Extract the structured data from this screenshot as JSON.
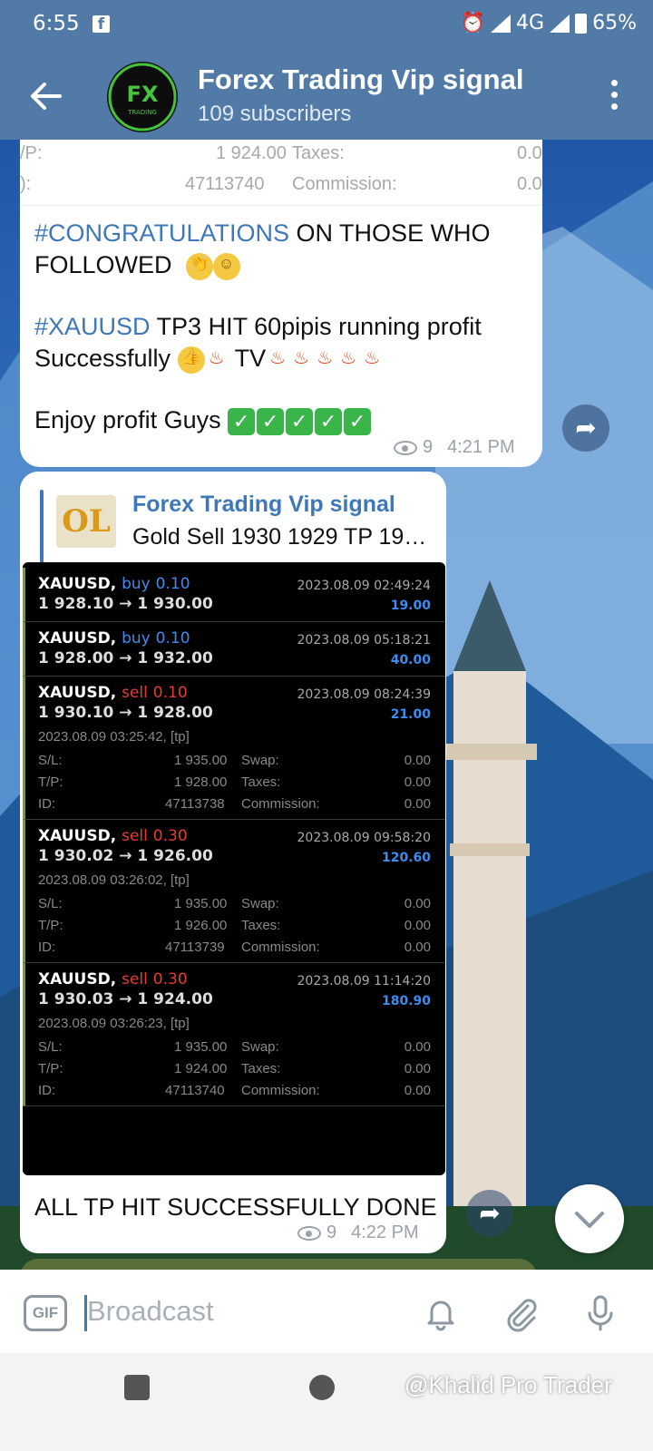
{
  "status_bar": {
    "time": "6:55",
    "network": "4G",
    "battery": "65%",
    "fb_label": "f"
  },
  "header": {
    "title": "Forex Trading Vip signal",
    "subscribers": "109 subscribers",
    "avatar_text": "FX",
    "avatar_sub": "TRADING"
  },
  "message1": {
    "partial_rows": [
      {
        "label": "/P:",
        "value": "1 924.00",
        "key": "Taxes:",
        "amount": "0.0"
      },
      {
        "label": "):",
        "value": "47113740",
        "key": "Commission:",
        "amount": "0.0"
      }
    ],
    "line1_tag": "#CONGRATULATIONS",
    "line1_rest": " ON THOSE WHO",
    "line2": "FOLLOWED",
    "line3_tag": "#XAUUSD",
    "line3_rest": "  TP3 HIT 60pipis running profit",
    "line4a": "Successfully",
    "line4b": "TV",
    "line5": "Enjoy profit Guys",
    "views": "9",
    "time": "4:21 PM"
  },
  "message2": {
    "reply_title": "Forex Trading Vip signal",
    "reply_text": "Gold Sell 1930 1929  TP 19…",
    "reply_thumb": "OL",
    "trades": [
      {
        "symbol": "XAUUSD,",
        "side": "buy",
        "lots": "0.10",
        "prices": "1 928.10 → 1 930.00",
        "date": "2023.08.09 02:49:24",
        "profit": "19.00"
      },
      {
        "symbol": "XAUUSD,",
        "side": "buy",
        "lots": "0.10",
        "prices": "1 928.00 → 1 932.00",
        "date": "2023.08.09 05:18:21",
        "profit": "40.00"
      },
      {
        "symbol": "XAUUSD,",
        "side": "sell",
        "lots": "0.10",
        "prices": "1 930.10 → 1 928.00",
        "date": "2023.08.09 08:24:39",
        "profit": "21.00",
        "open": "2023.08.09 03:25:42, [tp]",
        "sl": "1 935.00",
        "tp": "1 928.00",
        "id": "47113738",
        "swap": "0.00",
        "taxes": "0.00",
        "commission": "0.00"
      },
      {
        "symbol": "XAUUSD,",
        "side": "sell",
        "lots": "0.30",
        "prices": "1 930.02 → 1 926.00",
        "date": "2023.08.09 09:58:20",
        "profit": "120.60",
        "open": "2023.08.09 03:26:02, [tp]",
        "sl": "1 935.00",
        "tp": "1 926.00",
        "id": "47113739",
        "swap": "0.00",
        "taxes": "0.00",
        "commission": "0.00"
      },
      {
        "symbol": "XAUUSD,",
        "side": "sell",
        "lots": "0.30",
        "prices": "1 930.03 → 1 924.00",
        "date": "2023.08.09 11:14:20",
        "profit": "180.90",
        "open": "2023.08.09 03:26:23, [tp]",
        "sl": "1 935.00",
        "tp": "1 924.00",
        "id": "47113740",
        "swap": "0.00",
        "taxes": "0.00",
        "commission": "0.00"
      }
    ],
    "labels": {
      "sl": "S/L:",
      "tp": "T/P:",
      "id": "ID:",
      "swap": "Swap:",
      "taxes": "Taxes:",
      "commission": "Commission:"
    },
    "caption": "ALL TP HIT SUCCESSFULLY DONE",
    "views": "9",
    "time": "4:22 PM"
  },
  "composer": {
    "gif_label": "GIF",
    "placeholder": "Broadcast"
  },
  "watermark": "@Khalid Pro Trader",
  "colors": {
    "header": "#527aa6",
    "accent": "#3e78b8",
    "buy": "#3d8cf0",
    "sell": "#ea3a2e"
  },
  "icons": [
    "back-arrow-icon",
    "more-vertical-icon",
    "eye-icon",
    "forward-icon",
    "bell-icon",
    "paperclip-icon",
    "microphone-icon",
    "chevron-down-icon"
  ]
}
